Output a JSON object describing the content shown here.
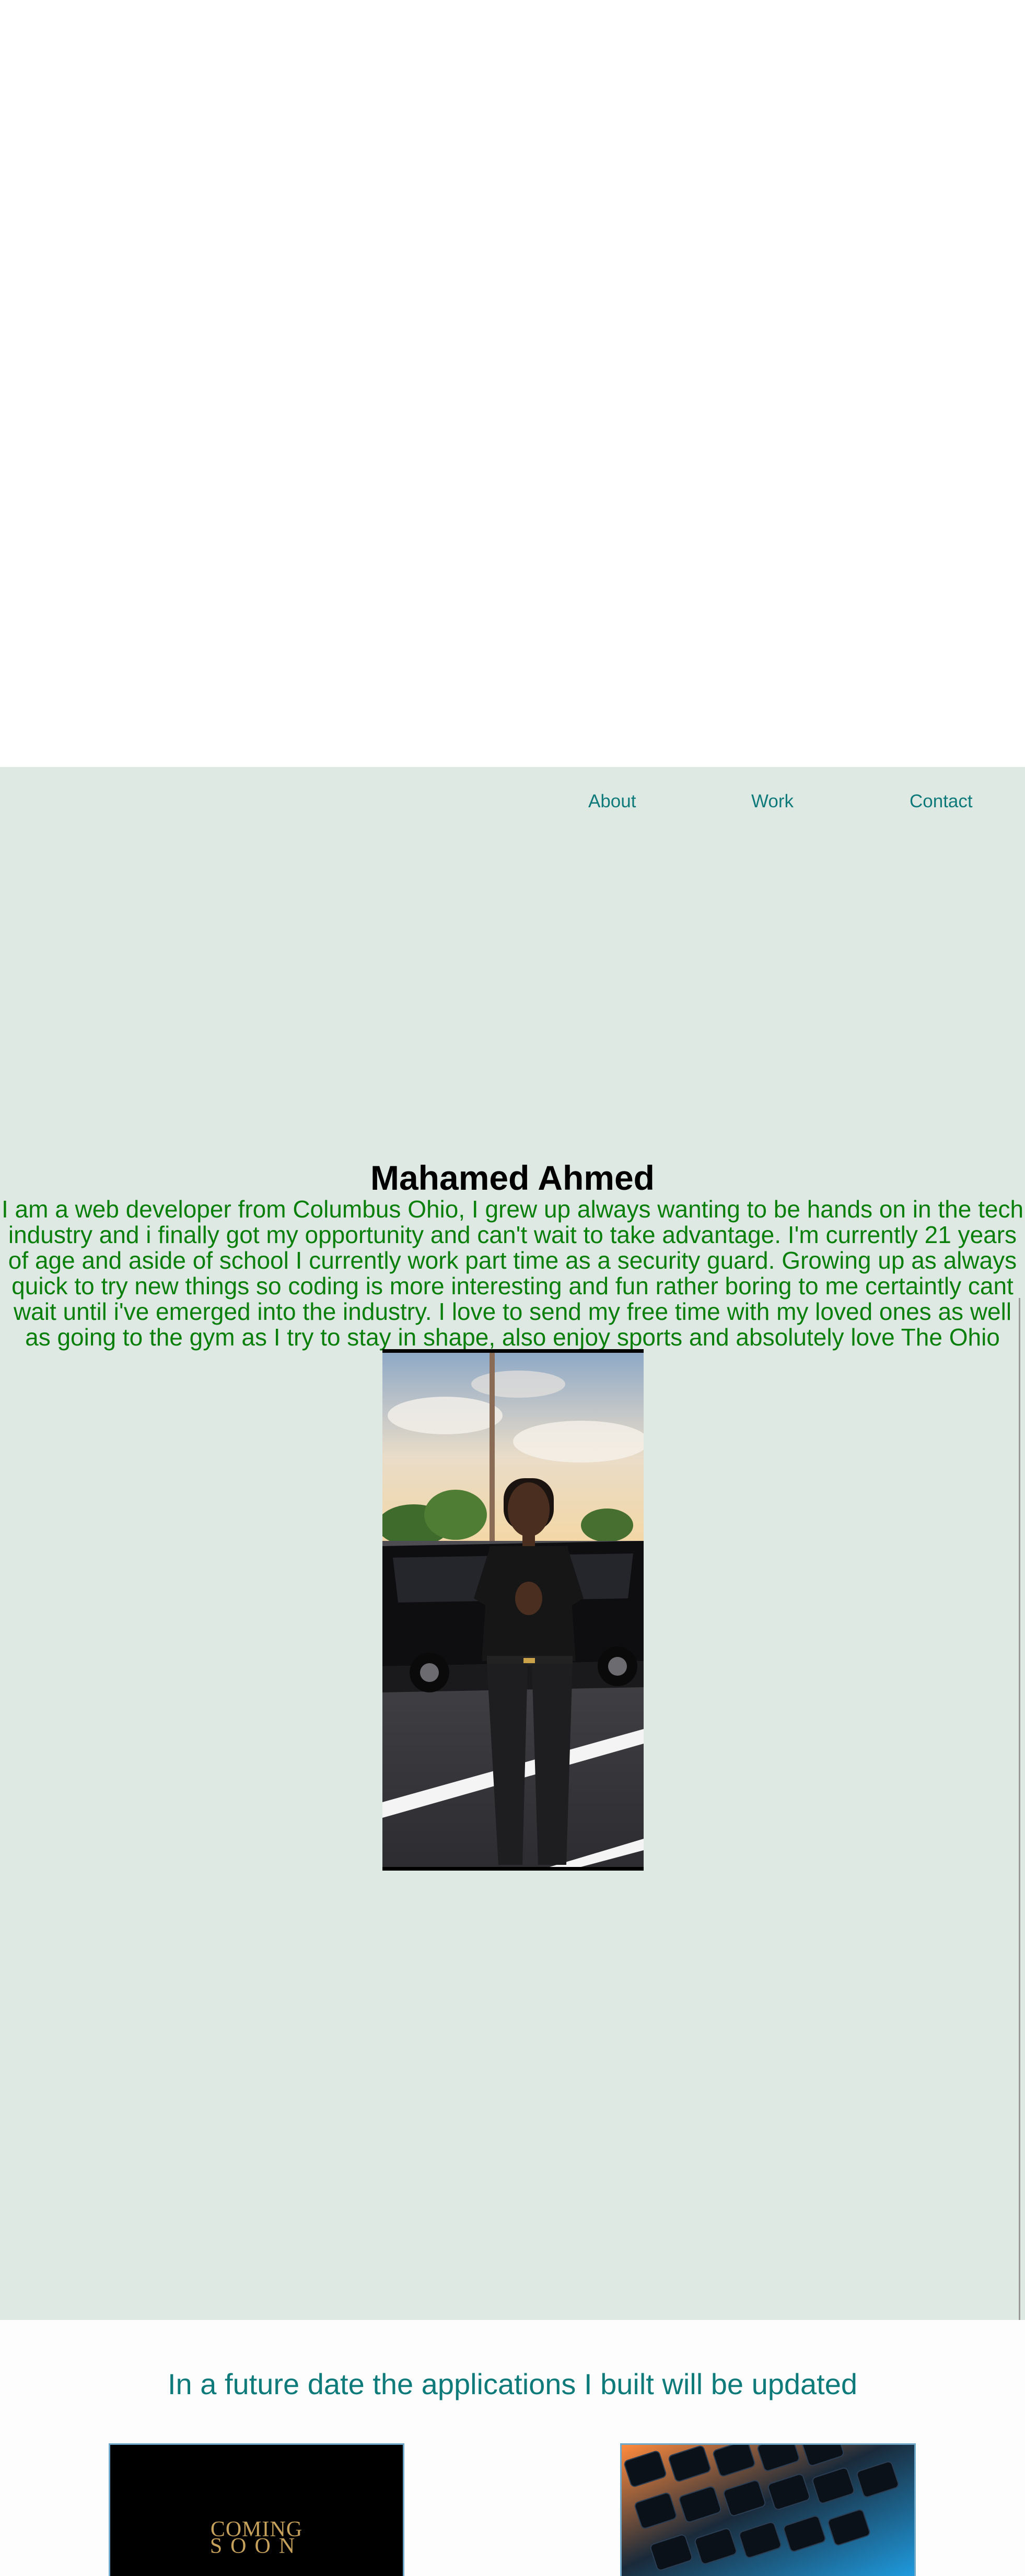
{
  "nav": {
    "items": [
      {
        "label": "About"
      },
      {
        "label": "Work"
      },
      {
        "label": "Contact"
      }
    ]
  },
  "about": {
    "name": "Mahamed Ahmed",
    "bio": "I am a web developer from Columbus Ohio, I grew up always wanting to be hands on in the tech industry and i finally got my opportunity and can't wait to take advantage. I'm currently 21 years of age and aside of school I currently work part time as a security guard. Growing up as always quick to try new things so coding is more interesting and fun rather boring to me certaintly cant wait until i've emerged into the industry. I love to send my free time with my loved ones as well as going to the gym as I try to stay in shape, also enjoy sports and absolutely love The Ohio State Buckeyes!"
  },
  "work": {
    "heading": "In a future date the applications I built will be updated",
    "cards": [
      {
        "line1": "COMING",
        "line2": "SOON"
      },
      {}
    ]
  },
  "colors": {
    "about_background": "#dfe9e4",
    "accent_teal": "#0f7a7a",
    "bio_green": "#0b7f0b"
  }
}
